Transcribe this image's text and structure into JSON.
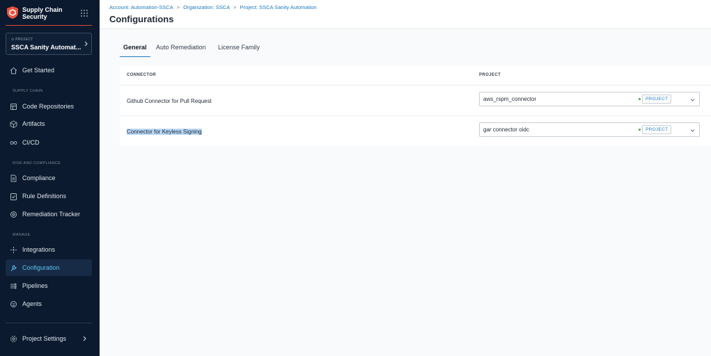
{
  "colors": {
    "sidebar_bg": "#0b1a2e",
    "accent": "#1f7bc0",
    "active_nav": "#59c3f0",
    "brand_red": "#d94a3a",
    "status_green": "#42ab45"
  },
  "brand": {
    "line1": "Supply Chain",
    "line2": "Security",
    "icon": "shield-logo-icon",
    "menu_icon": "grid-dots-icon"
  },
  "project_selector": {
    "caption": "PROJECT",
    "name": "SSCA Sanity Automat...",
    "icon": "chevron-right-icon"
  },
  "nav": {
    "get_started": {
      "label": "Get Started",
      "icon": "home-icon"
    },
    "supply_chain_section": "SUPPLY CHAIN",
    "code_repositories": {
      "label": "Code Repositories",
      "icon": "repository-icon"
    },
    "artifacts": {
      "label": "Artifacts",
      "icon": "cube-icon"
    },
    "cicd": {
      "label": "CI/CD",
      "icon": "infinity-icon"
    },
    "risk_section": "RISK AND COMPLIANCE",
    "compliance": {
      "label": "Compliance",
      "icon": "document-icon"
    },
    "rule_definitions": {
      "label": "Rule Definitions",
      "icon": "clipboard-check-icon"
    },
    "remediation_tracker": {
      "label": "Remediation Tracker",
      "icon": "tracker-icon"
    },
    "manage_section": "MANAGE",
    "integrations": {
      "label": "Integrations",
      "icon": "integrations-icon"
    },
    "configuration": {
      "label": "Configuration",
      "icon": "wrench-icon"
    },
    "pipelines": {
      "label": "Pipelines",
      "icon": "pipelines-icon"
    },
    "agents": {
      "label": "Agents",
      "icon": "agent-icon"
    },
    "project_settings": {
      "label": "Project Settings",
      "icon": "gear-icon"
    }
  },
  "breadcrumb": {
    "account": "Account: Automation-SSCA",
    "organization": "Organization: SSCA",
    "project": "Project: SSCA Sanity Automation",
    "separator": ">"
  },
  "page_title": "Configurations",
  "tabs": [
    {
      "label": "General",
      "active": true
    },
    {
      "label": "Auto Remediation",
      "active": false
    },
    {
      "label": "License Family",
      "active": false
    }
  ],
  "table": {
    "headers": {
      "connector": "CONNECTOR",
      "project": "PROJECT"
    },
    "rows": [
      {
        "connector": "Github Connector for Pull Request",
        "value": "aws_rspm_connector",
        "scope": "PROJECT"
      },
      {
        "connector": "Connector for Keyless Signing",
        "value": "gar connector oidc",
        "scope": "PROJECT"
      }
    ]
  }
}
